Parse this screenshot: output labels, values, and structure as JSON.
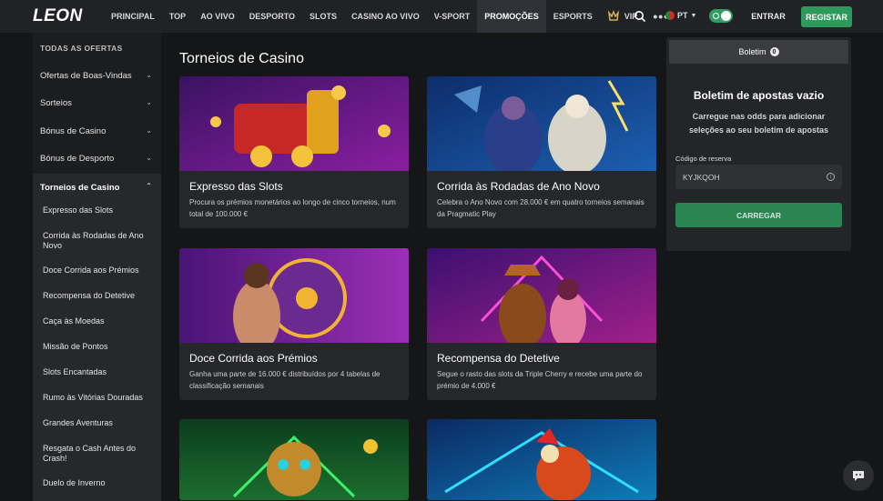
{
  "nav": {
    "logo": "LEON",
    "links": [
      "PRINCIPAL",
      "TOP",
      "AO VIVO",
      "DESPORTO",
      "SLOTS",
      "CASINO AO VIVO",
      "V-SPORT",
      "PROMOÇÕES",
      "ESPORTS"
    ],
    "vip": "VIP",
    "language": "PT",
    "login": "ENTRAR",
    "register": "REGISTAR"
  },
  "sidebar": {
    "header": "TODAS AS OFERTAS",
    "items": [
      "Ofertas de Boas-Vindas",
      "Sorteios",
      "Bónus de Casino",
      "Bónus de Desporto"
    ],
    "active_section": "Torneios de Casino",
    "subitems": [
      "Expresso das Slots",
      "Corrida às Rodadas de Ano Novo",
      "Doce Corrida aos Prémios",
      "Recompensa do Detetive",
      "Caça às Moedas",
      "Missão de Pontos",
      "Slots Encantadas",
      "Rumo às Vitórias Douradas",
      "Grandes Aventuras",
      "Resgata o Cash Antes do Crash!",
      "Duelo de Inverno"
    ]
  },
  "main": {
    "title": "Torneios de Casino",
    "cards": [
      {
        "title": "Expresso das Slots",
        "desc": "Procura os prémios monetários ao longo de cinco torneios, num total de 100.000 €"
      },
      {
        "title": "Corrida às Rodadas de Ano Novo",
        "desc": "Celebra o Ano Novo com 28.000 € em quatro torneios semanais da Pragmatic Play"
      },
      {
        "title": "Doce Corrida aos Prémios",
        "desc": "Ganha uma parte de 16.000 € distribuídos por 4 tabelas de classificação semanais"
      },
      {
        "title": "Recompensa do Detetive",
        "desc": "Segue o rasto das slots da Triple Cherry e recebe uma parte do prémio de 4.000 €"
      },
      {
        "title": "",
        "desc": ""
      },
      {
        "title": "",
        "desc": ""
      }
    ]
  },
  "betslip": {
    "tab": "Boletim",
    "count": "0",
    "empty_title": "Boletim de apostas vazio",
    "hint": "Carregue nas odds para adicionar seleções ao seu boletim de apostas",
    "code_label": "Código de reserva",
    "code_value": "KYJKQOH",
    "load_button": "CARREGAR"
  }
}
